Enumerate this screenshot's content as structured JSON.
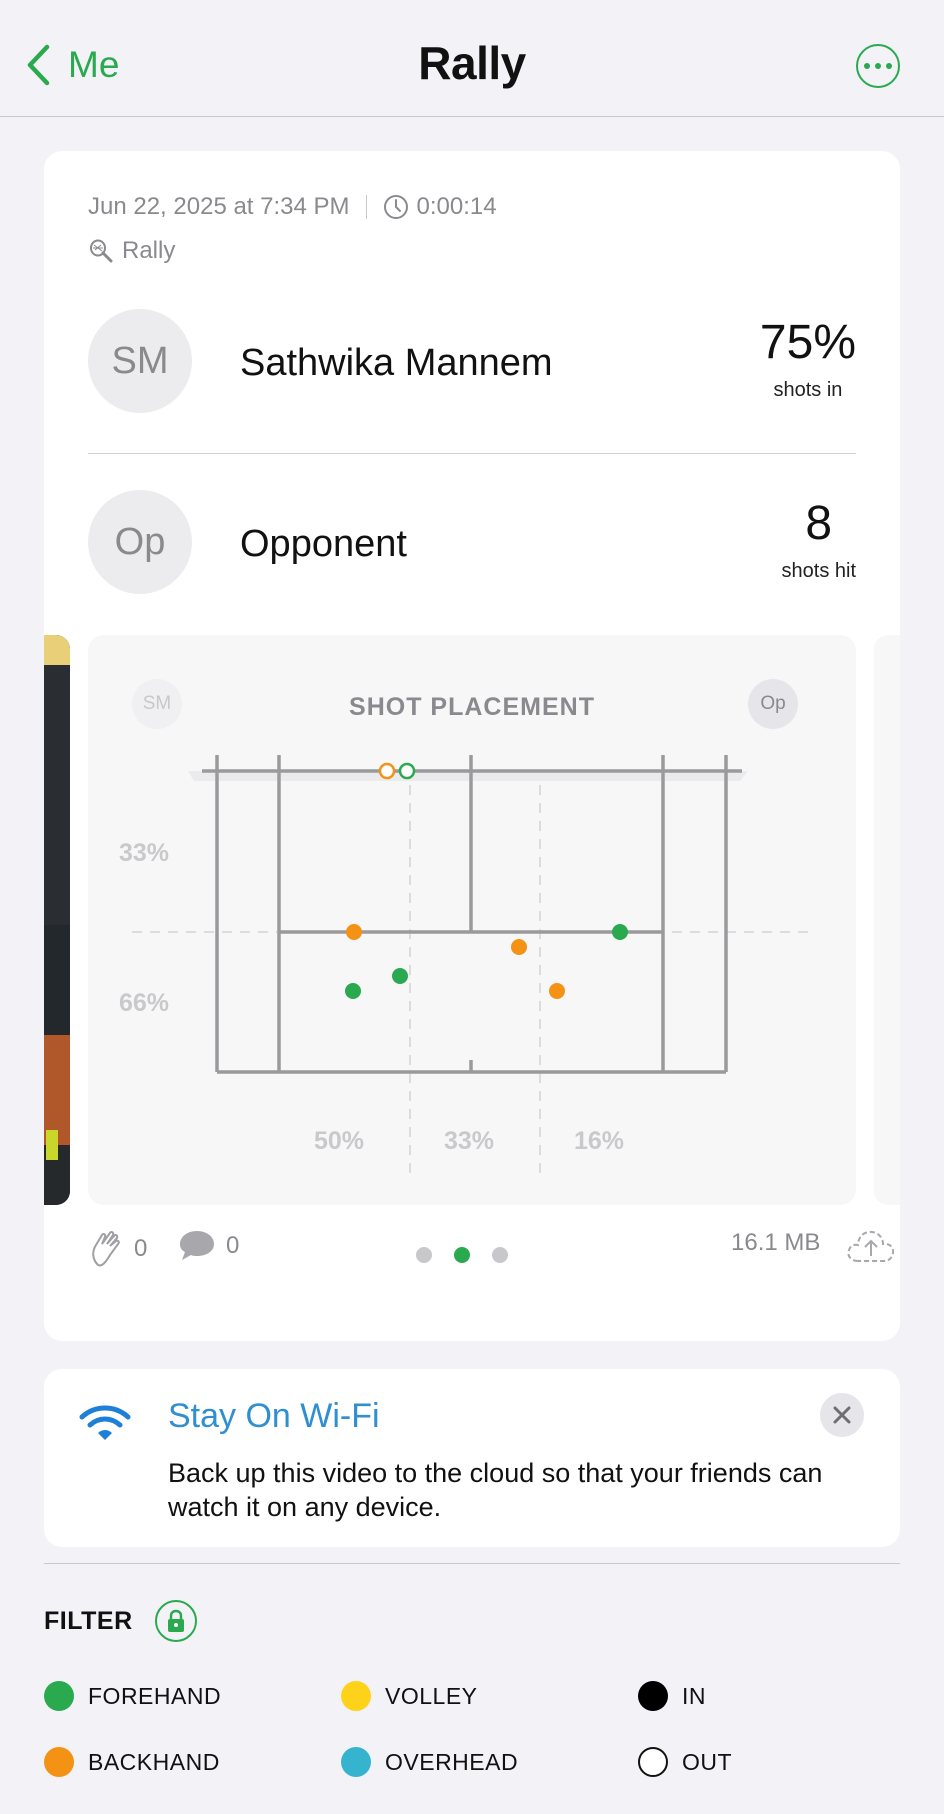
{
  "nav": {
    "back_label": "Me",
    "title": "Rally"
  },
  "session": {
    "datetime": "Jun 22, 2025 at 7:34 PM",
    "duration": "0:00:14",
    "type": "Rally"
  },
  "players": [
    {
      "initials": "SM",
      "name": "Sathwika Mannem",
      "stat_value": "75%",
      "stat_label": "shots in"
    },
    {
      "initials": "Op",
      "name": "Opponent",
      "stat_value": "8",
      "stat_label": "shots hit"
    }
  ],
  "placement": {
    "title": "SHOT PLACEMENT",
    "left_avatar": "SM",
    "right_avatar": "Op",
    "row_pcts": [
      "33%",
      "66%"
    ],
    "col_pcts": [
      "50%",
      "33%",
      "16%"
    ],
    "colors": {
      "forehand": "#2aa94f",
      "backhand": "#f39214"
    }
  },
  "footer": {
    "likes": "0",
    "comments": "0",
    "size": "16.1 MB",
    "page_count": 3,
    "active_page": 2
  },
  "wifi": {
    "title": "Stay On Wi-Fi",
    "body": "Back up this video to the cloud so that your friends can watch it on any device."
  },
  "filter": {
    "label": "FILTER",
    "items": [
      {
        "label": "FOREHAND",
        "color": "#2aa94f"
      },
      {
        "label": "VOLLEY",
        "color": "#ffd21a"
      },
      {
        "label": "IN",
        "color": "#000000"
      },
      {
        "label": "BACKHAND",
        "color": "#f39214"
      },
      {
        "label": "OVERHEAD",
        "color": "#36b4cf"
      },
      {
        "label": "OUT",
        "color": "#ffffff"
      }
    ]
  }
}
